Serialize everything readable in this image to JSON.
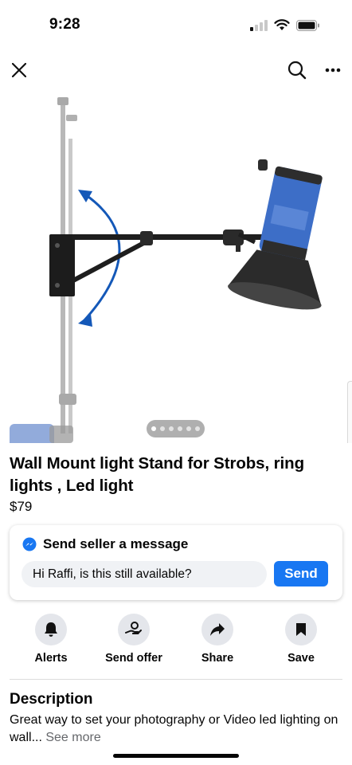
{
  "status_bar": {
    "time": "9:28"
  },
  "icons": {
    "close": "close-icon",
    "search": "search-icon",
    "more": "more-icon",
    "messenger": "messenger-icon"
  },
  "gallery": {
    "photo_count": 6,
    "active_index": 0
  },
  "listing": {
    "title": "Wall Mount light Stand for Strobs, ring lights , Led light",
    "price": "$79"
  },
  "message_card": {
    "title": "Send seller a message",
    "input_value": "Hi Raffi, is this still available?",
    "send_label": "Send"
  },
  "actions": [
    {
      "label": "Alerts",
      "icon": "bell-icon"
    },
    {
      "label": "Send offer",
      "icon": "offer-icon"
    },
    {
      "label": "Share",
      "icon": "share-icon"
    },
    {
      "label": "Save",
      "icon": "bookmark-icon"
    }
  ],
  "description": {
    "heading": "Description",
    "text": "Great way to set your photography or Video led lighting on wall...",
    "see_more": "See more"
  },
  "colors": {
    "accent": "#1877f2",
    "icon_bg": "#e4e6eb",
    "arrow_blue": "#1458b8"
  }
}
